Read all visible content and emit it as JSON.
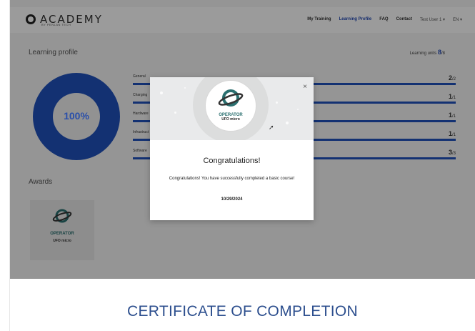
{
  "header": {
    "logo_text": "ACADEMY",
    "logo_sub": "BY PENLAN TECH",
    "nav": [
      {
        "label": "My Training"
      },
      {
        "label": "Learning Profile"
      },
      {
        "label": "FAQ"
      },
      {
        "label": "Contact"
      }
    ],
    "user_label": "Test User 1 ▾",
    "lang_label": "EN ▾"
  },
  "profile": {
    "title": "Learning profile",
    "units_label": "Learning units",
    "units_done": "8",
    "units_total": "/8",
    "percent_label": "100%",
    "percent_value": 100,
    "categories": [
      {
        "label": "General",
        "done": "2",
        "total": "/2"
      },
      {
        "label": "Charging",
        "done": "1",
        "total": "/1"
      },
      {
        "label": "Hardware",
        "done": "1",
        "total": "/1"
      },
      {
        "label": "Infrastruct",
        "done": "1",
        "total": "/1"
      },
      {
        "label": "Software",
        "done": "3",
        "total": "/3"
      }
    ]
  },
  "awards": {
    "title": "Awards",
    "card": {
      "name": "OPERATOR",
      "sub": "UFO micro"
    }
  },
  "modal": {
    "badge_name": "OPERATOR",
    "badge_sub": "UFO micro",
    "close_glyph": "×",
    "title": "Congratulations!",
    "message": "Congratulations! You have successfully completed a basic course!",
    "date": "10/29/2024"
  },
  "caption": "CERTIFICATE OF COMPLETION",
  "colors": {
    "accent": "#2050b8",
    "badge_teal": "#2a6f6f",
    "caption": "#2d4f8e"
  }
}
